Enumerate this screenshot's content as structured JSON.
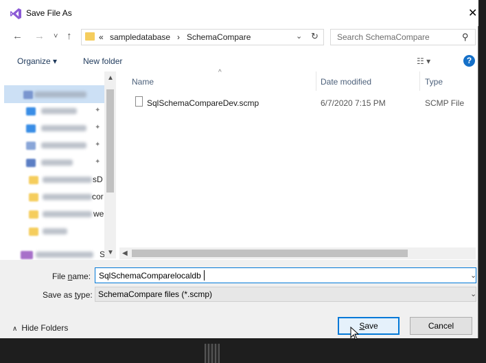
{
  "window": {
    "title": "Save File As",
    "close_glyph": "✕"
  },
  "nav": {
    "back": "←",
    "forward": "→",
    "recent": "˅",
    "up": "↑"
  },
  "address": {
    "overflow": "«",
    "crumbs": [
      "sampledatabase",
      "SchemaCompare"
    ],
    "separator": "›",
    "dropdown": "⌄",
    "refresh": "↻"
  },
  "search": {
    "placeholder": "Search SchemaCompare",
    "icon": "search-icon"
  },
  "toolbar": {
    "organize": "Organize ▾",
    "new_folder": "New folder",
    "view_glyph": "☷ ▾",
    "help": "?"
  },
  "nav_pane": {
    "items": [
      {
        "tail": "",
        "pinned": false,
        "icon_color": "#7a96cf"
      },
      {
        "tail": "",
        "pinned": true,
        "icon_color": "#3a8ee6"
      },
      {
        "tail": "",
        "pinned": true,
        "icon_color": "#3a8ee6"
      },
      {
        "tail": "",
        "pinned": true,
        "icon_color": "#8aa6d8"
      },
      {
        "tail": "",
        "pinned": true,
        "icon_color": "#5b7ec4"
      },
      {
        "tail": "sD",
        "pinned": false,
        "icon_color": "#f5cd5d"
      },
      {
        "tail": "cor",
        "pinned": false,
        "icon_color": "#f5cd5d"
      },
      {
        "tail": "we",
        "pinned": false,
        "icon_color": "#f5cd5d"
      },
      {
        "tail": "",
        "pinned": false,
        "icon_color": "#f5cd5d"
      },
      {
        "tail": "S",
        "pinned": false,
        "icon_color": "#a770c9"
      }
    ],
    "pin_glyph": "📌"
  },
  "file_list": {
    "columns": {
      "name": "Name",
      "date": "Date modified",
      "type": "Type"
    },
    "files": [
      {
        "name": "SqlSchemaCompareDev.scmp",
        "date": "6/7/2020 7:15 PM",
        "type": "SCMP File"
      }
    ]
  },
  "form": {
    "file_name_label_pre": "File ",
    "file_name_label_u": "n",
    "file_name_label_post": "ame:",
    "file_name_value": "SqlSchemaComparelocaldb",
    "save_type_label_pre": "Save as ",
    "save_type_label_u": "t",
    "save_type_label_post": "ype:",
    "save_type_value": "SchemaCompare files (*.scmp)"
  },
  "footer": {
    "hide_folders": "Hide Folders",
    "save_u": "S",
    "save_rest": "ave",
    "cancel": "Cancel"
  },
  "colors": {
    "accent": "#0078d7",
    "link": "#1e395b",
    "folder": "#f5cd5d",
    "help": "#1570c8"
  }
}
